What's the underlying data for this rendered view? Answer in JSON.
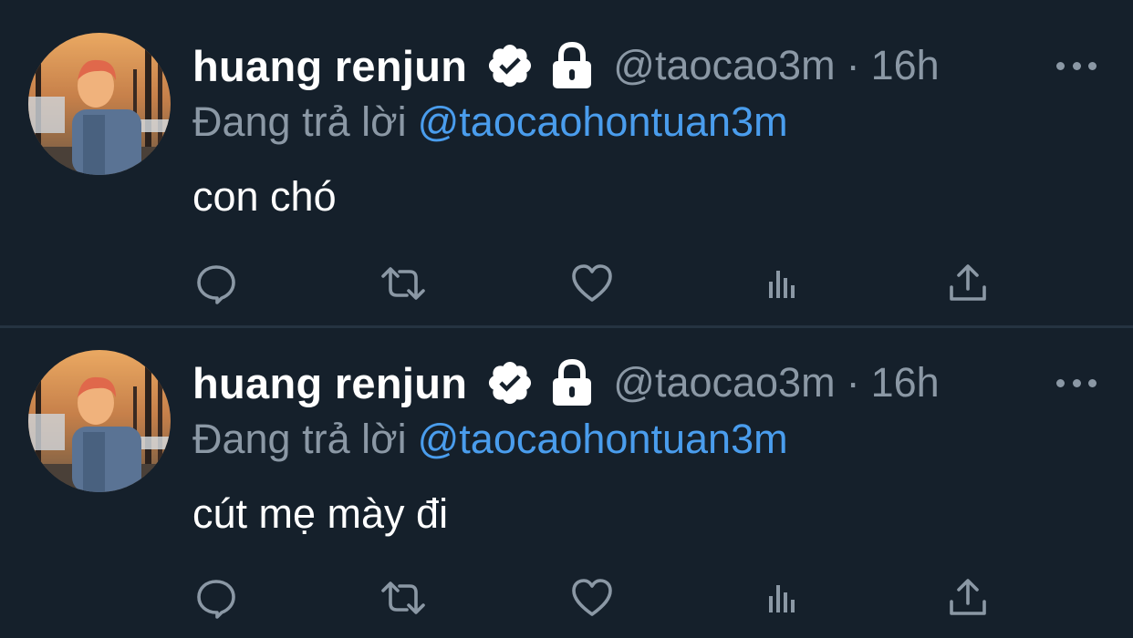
{
  "colors": {
    "background": "#15202b",
    "text_primary": "#ffffff",
    "text_secondary": "#8b98a5",
    "accent": "#4a9ded",
    "divider": "#253341"
  },
  "tweets": [
    {
      "author": {
        "display_name": "huang renjun",
        "handle": "@taocao3m",
        "avatar_icon": "profile-photo",
        "verified_icon": "verified-badge-icon",
        "protected_icon": "lock-icon"
      },
      "separator": "·",
      "time": "16h",
      "reply_prefix": "Đang trả lời",
      "reply_to": "@taocaohontuan3m",
      "text": "con chó",
      "actions": [
        "reply-icon",
        "retweet-icon",
        "like-icon",
        "views-icon",
        "share-icon"
      ]
    },
    {
      "author": {
        "display_name": "huang renjun",
        "handle": "@taocao3m",
        "avatar_icon": "profile-photo",
        "verified_icon": "verified-badge-icon",
        "protected_icon": "lock-icon"
      },
      "separator": "·",
      "time": "16h",
      "reply_prefix": "Đang trả lời",
      "reply_to": "@taocaohontuan3m",
      "text": "cút mẹ mày đi",
      "actions": [
        "reply-icon",
        "retweet-icon",
        "like-icon",
        "views-icon",
        "share-icon"
      ]
    }
  ]
}
